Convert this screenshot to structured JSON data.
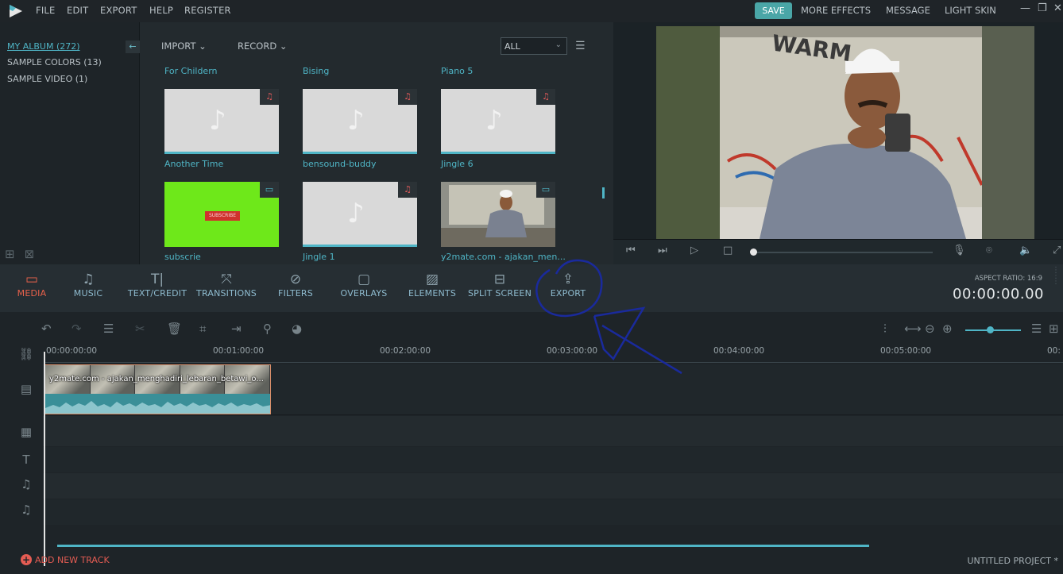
{
  "menubar": {
    "items": [
      "FILE",
      "EDIT",
      "EXPORT",
      "HELP",
      "REGISTER"
    ],
    "save_label": "SAVE",
    "right_items": [
      "MORE EFFECTS",
      "MESSAGE",
      "LIGHT SKIN"
    ]
  },
  "albums": {
    "items": [
      "MY ALBUM (272)",
      "SAMPLE COLORS (13)",
      "SAMPLE VIDEO (1)"
    ]
  },
  "library": {
    "import_label": "IMPORT",
    "record_label": "RECORD",
    "filter_value": "ALL",
    "top_labels": [
      "For Childern",
      "Bising",
      "Piano 5"
    ],
    "items": [
      {
        "label": "Another Time",
        "kind": "audio"
      },
      {
        "label": "bensound-buddy",
        "kind": "audio"
      },
      {
        "label": "Jingle 6",
        "kind": "audio"
      },
      {
        "label": "subscrie",
        "kind": "video",
        "overlay_text": "SUBSCRIBE"
      },
      {
        "label": "Jingle 1",
        "kind": "audio"
      },
      {
        "label": "y2mate.com - ajakan_men...",
        "kind": "video"
      }
    ]
  },
  "toolbar": {
    "tools": [
      "MEDIA",
      "MUSIC",
      "TEXT/CREDIT",
      "TRANSITIONS",
      "FILTERS",
      "OVERLAYS",
      "ELEMENTS",
      "SPLIT SCREEN",
      "EXPORT"
    ],
    "aspect_ratio": "ASPECT RATIO: 16:9",
    "timecode": "00:00:00.00"
  },
  "timeline": {
    "ruler": [
      "00:00:00:00",
      "00:01:00:00",
      "00:02:00:00",
      "00:03:00:00",
      "00:04:00:00",
      "00:05:00:00",
      "00:"
    ],
    "clip_name": "y2mate.com - ajakan_menghadiri_lebaran_betawi_o...",
    "add_track": "ADD NEW TRACK",
    "project_name": "UNTITLED PROJECT *"
  },
  "colors": {
    "accent": "#4fb5c6",
    "active_tool": "#e8614b",
    "annotation": "#1a2a9c"
  }
}
